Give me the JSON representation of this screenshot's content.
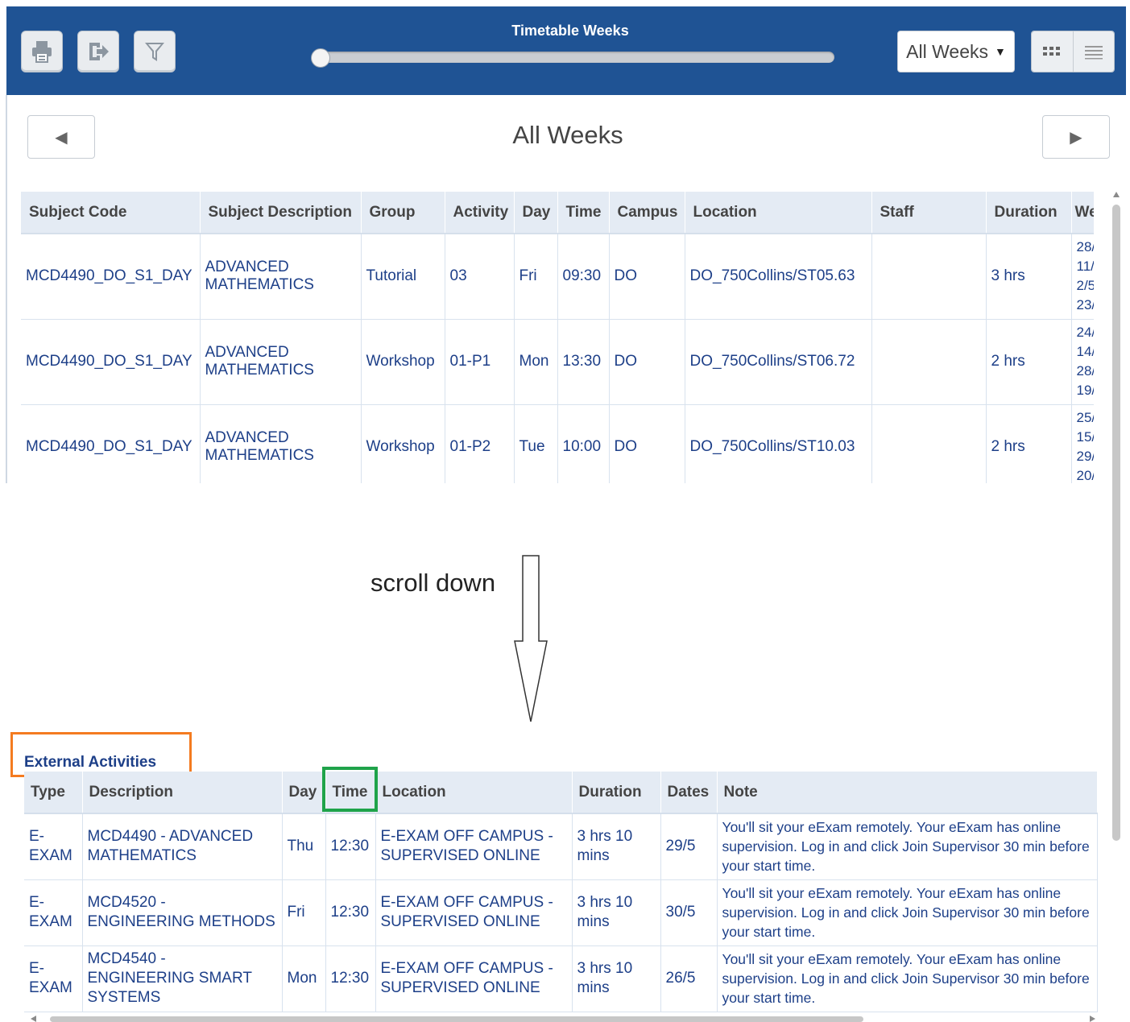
{
  "header": {
    "slider_title": "Timetable Weeks",
    "slider_position": 0,
    "weeks_dropdown": "All Weeks",
    "colors": {
      "bar": "#1f5394",
      "accent_orange": "#f47b20",
      "accent_green": "#1fa34a",
      "link": "#1d3f88"
    },
    "icons": [
      "printer-icon",
      "export-icon",
      "filter-icon",
      "grid-view-icon",
      "list-view-icon"
    ]
  },
  "week_nav": {
    "title": "All Weeks"
  },
  "timetable": {
    "columns": [
      "Subject Code",
      "Subject Description",
      "Group",
      "Activity",
      "Day",
      "Time",
      "Campus",
      "Location",
      "Staff",
      "Duration",
      "We"
    ],
    "rows": [
      {
        "subject_code": "MCD4490_DO_S1_DAY",
        "subject_desc": "ADVANCED MATHEMATICS",
        "group": "Tutorial",
        "activity": "03",
        "day": "Fri",
        "time": "09:30",
        "campus": "DO",
        "location": "DO_750Collins/ST05.63",
        "staff": "",
        "duration": "3 hrs",
        "weeks": [
          "28/",
          "11/",
          "2/5",
          "23/"
        ]
      },
      {
        "subject_code": "MCD4490_DO_S1_DAY",
        "subject_desc": "ADVANCED MATHEMATICS",
        "group": "Workshop",
        "activity": "01-P1",
        "day": "Mon",
        "time": "13:30",
        "campus": "DO",
        "location": "DO_750Collins/ST06.72",
        "staff": "",
        "duration": "2 hrs",
        "weeks": [
          "24/",
          "14/",
          "28/",
          "19/"
        ]
      },
      {
        "subject_code": "MCD4490_DO_S1_DAY",
        "subject_desc": "ADVANCED MATHEMATICS",
        "group": "Workshop",
        "activity": "01-P2",
        "day": "Tue",
        "time": "10:00",
        "campus": "DO",
        "location": "DO_750Collins/ST10.03",
        "staff": "",
        "duration": "2 hrs",
        "weeks": [
          "25/",
          "15/",
          "29/",
          "20/"
        ]
      }
    ]
  },
  "annotation": {
    "scroll_text": "scroll down"
  },
  "external": {
    "title": "External Activities",
    "columns": [
      "Type",
      "Description",
      "Day",
      "Time",
      "Location",
      "Duration",
      "Dates",
      "Note"
    ],
    "rows": [
      {
        "type": "E-EXAM",
        "description": "MCD4490 - ADVANCED MATHEMATICS",
        "day": "Thu",
        "time": "12:30",
        "location": "E-EXAM OFF CAMPUS - SUPERVISED ONLINE",
        "duration": "3 hrs 10 mins",
        "dates": "29/5",
        "note": "You'll sit your eExam remotely. Your eExam has online supervision. Log in and click Join Supervisor 30 min before your start time."
      },
      {
        "type": "E-EXAM",
        "description": "MCD4520 - ENGINEERING METHODS",
        "day": "Fri",
        "time": "12:30",
        "location": "E-EXAM OFF CAMPUS - SUPERVISED ONLINE",
        "duration": "3 hrs 10 mins",
        "dates": "30/5",
        "note": "You'll sit your eExam remotely. Your eExam has online supervision. Log in and click Join Supervisor 30 min before your start time."
      },
      {
        "type": "E-EXAM",
        "description": "MCD4540 - ENGINEERING SMART SYSTEMS",
        "day": "Mon",
        "time": "12:30",
        "location": "E-EXAM OFF CAMPUS - SUPERVISED ONLINE",
        "duration": "3 hrs 10 mins",
        "dates": "26/5",
        "note": "You'll sit your eExam remotely. Your eExam has online supervision. Log in and click Join Supervisor 30 min before your start time."
      }
    ]
  }
}
